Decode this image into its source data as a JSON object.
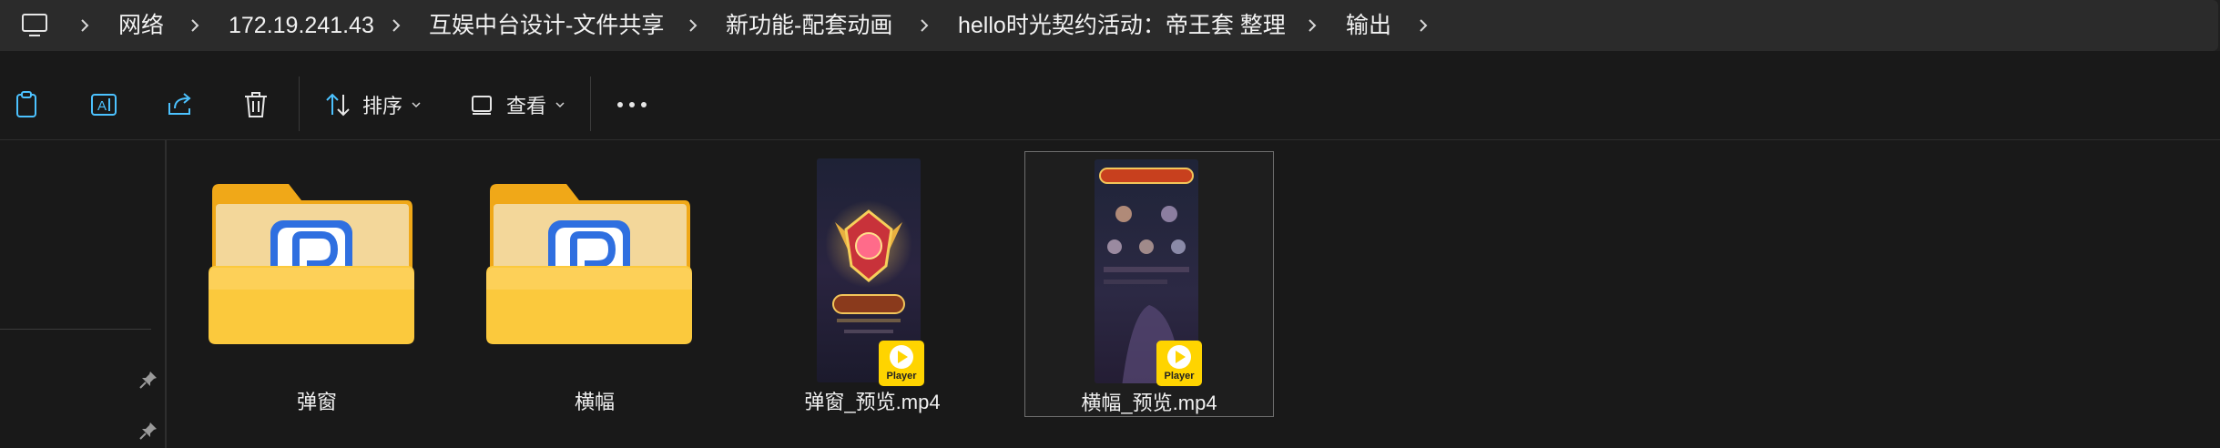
{
  "address_bar": {
    "crumbs": [
      "网络",
      "172.19.241.43",
      "互娱中台设计-文件共享",
      "新功能-配套动画",
      "hello时光契约活动：帝王套 整理",
      "输出"
    ],
    "root_icon": "computer-icon"
  },
  "toolbar": {
    "copy_icon": "clipboard-icon",
    "rename_icon": "rename-icon",
    "share_icon": "share-icon",
    "delete_icon": "trash-icon",
    "sort_label": "排序",
    "view_label": "查看",
    "more_icon": "more-icon"
  },
  "nav_pane": {
    "pins": [
      "pin-icon",
      "pin-icon"
    ]
  },
  "items": [
    {
      "name": "弹窗",
      "type": "folder"
    },
    {
      "name": "横幅",
      "type": "folder"
    },
    {
      "name": "弹窗_预览.mp4",
      "type": "video",
      "badge": "Player"
    },
    {
      "name": "横幅_预览.mp4",
      "type": "video",
      "badge": "Player",
      "selected": true
    }
  ],
  "colors": {
    "folder_yellow": "#f8c53a",
    "accent_blue": "#4cc2ff",
    "player_badge": "#ffd400"
  }
}
